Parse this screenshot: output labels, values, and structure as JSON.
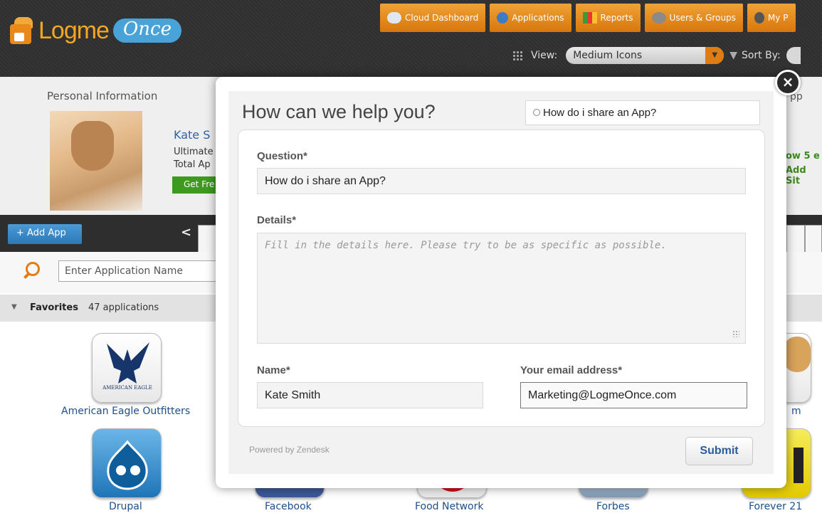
{
  "header": {
    "logo_text": "Logme",
    "logo_cloud": "Once",
    "nav": [
      {
        "label": "Cloud Dashboard",
        "icon": "cloud-icon"
      },
      {
        "label": "Applications",
        "icon": "globe-icon"
      },
      {
        "label": "Reports",
        "icon": "bar-chart-icon"
      },
      {
        "label": "Users & Groups",
        "icon": "users-icon"
      },
      {
        "label": "My P",
        "icon": "user-icon"
      }
    ],
    "view_label": "View:",
    "view_value": "Medium Icons",
    "sort_label": "Sort By:"
  },
  "personal": {
    "title": "Personal Information",
    "name": "Kate S",
    "line1": "Ultimate",
    "line2": "Total Ap",
    "get_button": "Get Fre",
    "right_app": "pp",
    "right_line1": "ow 5 e",
    "right_line2": "Add Sit"
  },
  "toolbar": {
    "add_app": "+ Add App",
    "search_placeholder": "Enter Application Name"
  },
  "favorites": {
    "title": "Favorites",
    "count": "47 applications"
  },
  "apps": [
    {
      "label": "American Eagle Outfitters",
      "tile_text": "AMERICAN EAGLE"
    },
    {
      "label": "Drupal"
    },
    {
      "label": "Facebook"
    },
    {
      "label": "Food Network"
    },
    {
      "label": "Forbes"
    },
    {
      "label": "Forever 21"
    },
    {
      "label": "m"
    }
  ],
  "modal": {
    "title": "How can we help you?",
    "search_value": "How do i share an App?",
    "question_label": "Question*",
    "question_value": "How do i share an App?",
    "details_label": "Details*",
    "details_placeholder": "Fill in the details here. Please try to be as specific as possible.",
    "name_label": "Name*",
    "name_value": "Kate Smith",
    "email_label": "Your email address*",
    "email_value": "Marketing@LogmeOnce.com",
    "powered_by": "Powered by Zendesk",
    "submit_label": "Submit",
    "close_glyph": "×"
  },
  "colors": {
    "accent_orange": "#e07d12",
    "link_blue": "#2b63a8",
    "submit_blue": "#2b5d9a"
  }
}
